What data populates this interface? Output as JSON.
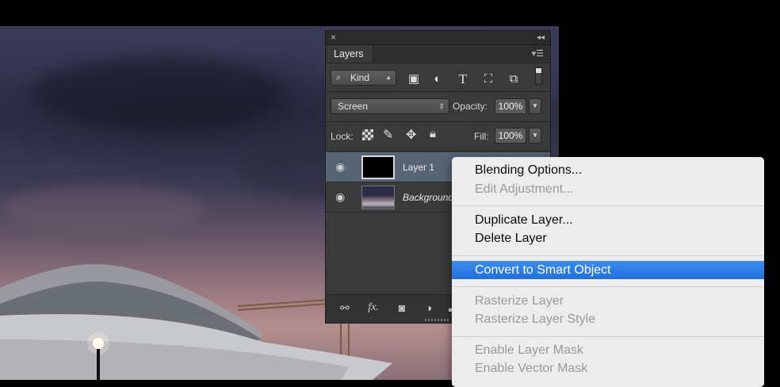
{
  "panel": {
    "close_icon": "×",
    "collapse_icon": "◂◂",
    "tab_label": "Layers",
    "tab_menu_icon": "menu-icon",
    "filter": {
      "kind_label": "Kind",
      "icons": [
        "image-filter-icon",
        "adjustment-filter-icon",
        "type-filter-icon",
        "shape-filter-icon",
        "smart-object-filter-icon",
        "filter-toggle-icon"
      ]
    },
    "blend_mode": "Screen",
    "opacity_label": "Opacity:",
    "opacity_value": "100%",
    "lock_label": "Lock:",
    "fill_label": "Fill:",
    "fill_value": "100%",
    "layers": [
      {
        "name": "Layer 1",
        "selected": true,
        "visible": true
      },
      {
        "name": "Background",
        "selected": false,
        "visible": true
      }
    ],
    "bottom_icons": [
      "link-layers-icon",
      "fx-icon",
      "layer-mask-icon",
      "adjustment-layer-icon",
      "new-group-icon"
    ]
  },
  "context_menu": {
    "items": [
      {
        "label": "Blending Options...",
        "enabled": true
      },
      {
        "label": "Edit Adjustment...",
        "enabled": false
      },
      {
        "separator": true
      },
      {
        "label": "Duplicate Layer...",
        "enabled": true
      },
      {
        "label": "Delete Layer",
        "enabled": true
      },
      {
        "separator": true
      },
      {
        "label": "Convert to Smart Object",
        "enabled": true,
        "highlighted": true
      },
      {
        "separator": true
      },
      {
        "label": "Rasterize Layer",
        "enabled": false
      },
      {
        "label": "Rasterize Layer Style",
        "enabled": false
      },
      {
        "separator": true
      },
      {
        "label": "Enable Layer Mask",
        "enabled": false
      },
      {
        "label": "Enable Vector Mask",
        "enabled": false
      }
    ],
    "highlight_color": "#2a78e8"
  }
}
